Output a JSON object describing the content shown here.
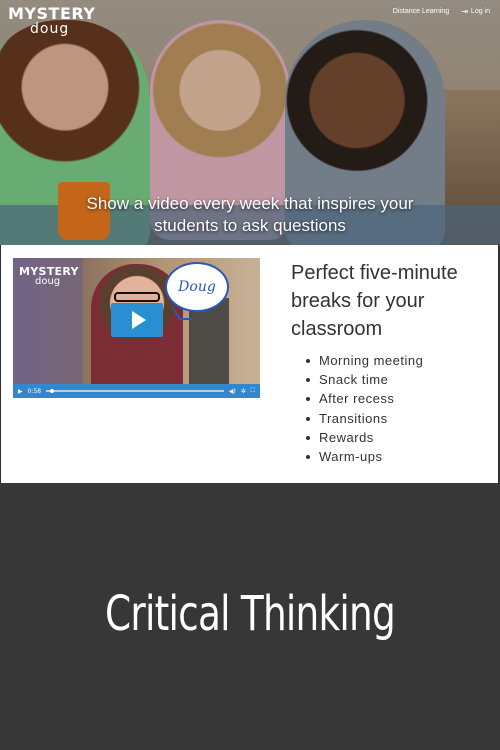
{
  "hero": {
    "logo_line1": "MYSTERY",
    "logo_line2": "doug",
    "nav": [
      {
        "label": "Distance Learning"
      },
      {
        "label": "Log in",
        "icon": "login-icon"
      }
    ],
    "caption_line1": "Show a video every week that inspires your",
    "caption_line2": "students to ask questions"
  },
  "video": {
    "logo_line1": "MYSTERY",
    "logo_line2": "doug",
    "bubble_text": "Doug",
    "time": "0:58",
    "progress": 0.02,
    "player_color": "#3387cf"
  },
  "features": {
    "headline": "Perfect five-minute breaks for your classroom",
    "items": [
      "Morning meeting",
      "Snack time",
      "After recess",
      "Transitions",
      "Rewards",
      "Warm-ups"
    ]
  },
  "banner": {
    "title": "Critical Thinking"
  }
}
